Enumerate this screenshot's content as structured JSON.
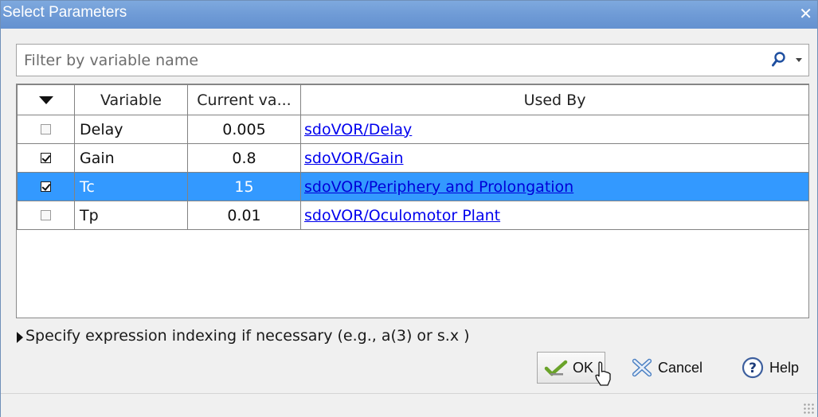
{
  "window": {
    "title": "Select Parameters",
    "close_glyph": "✕"
  },
  "filter": {
    "placeholder": "Filter by variable name",
    "value": "",
    "icon": "search-icon"
  },
  "table": {
    "columns": [
      "Variable",
      "Current va...",
      "Used By"
    ],
    "rows": [
      {
        "checked": false,
        "variable": "Delay",
        "value": "0.005",
        "used_by": "sdoVOR/Delay",
        "selected": false
      },
      {
        "checked": true,
        "variable": "Gain",
        "value": "0.8",
        "used_by": "sdoVOR/Gain",
        "selected": false
      },
      {
        "checked": true,
        "variable": "Tc",
        "value": "15",
        "used_by": "sdoVOR/Periphery and Prolongation",
        "selected": true
      },
      {
        "checked": false,
        "variable": "Tp",
        "value": "0.01",
        "used_by": "sdoVOR/Oculomotor Plant",
        "selected": false
      }
    ]
  },
  "expression": {
    "label": "Specify expression indexing if necessary (e.g., a(3) or s.x )"
  },
  "buttons": {
    "ok": "OK",
    "cancel": "Cancel",
    "help": "Help"
  },
  "colors": {
    "title_bar": "#6f9bd6",
    "selection": "#3399ff",
    "link": "#0000ee"
  }
}
